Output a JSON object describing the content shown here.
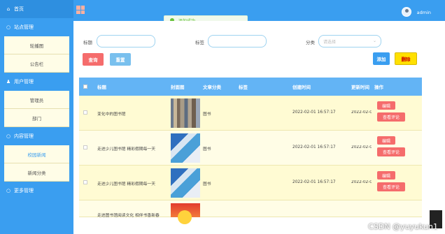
{
  "topbar": {
    "admin_label": "admin"
  },
  "toast": {
    "message": "添加成功"
  },
  "sidebar": {
    "items": [
      {
        "label": "首页",
        "icon": "home-icon"
      },
      {
        "label": "站点管理",
        "icon": "site-icon"
      },
      {
        "label": "轮播图",
        "sub": true
      },
      {
        "label": "公告栏",
        "sub": true
      },
      {
        "label": "用户管理",
        "icon": "user-icon"
      },
      {
        "label": "管理员",
        "sub": true
      },
      {
        "label": "部门",
        "sub": true
      },
      {
        "label": "内容管理",
        "icon": "content-icon"
      },
      {
        "label": "校园新闻",
        "sub": true
      },
      {
        "label": "新闻分类",
        "sub": true
      },
      {
        "label": "更多管理",
        "icon": "more-icon"
      }
    ]
  },
  "search": {
    "title_label": "标题",
    "tag_label": "标签",
    "category_label": "分类",
    "category_placeholder": "请选择",
    "query_button": "查询",
    "reset_button": "重置",
    "add_button": "添加",
    "delete_button": "删除"
  },
  "table": {
    "headers": [
      "标题",
      "封面图",
      "文章分类",
      "标签",
      "创建时间",
      "更新时间",
      "操作"
    ],
    "rows": [
      {
        "title": "变化中的图书馆",
        "category": "图书",
        "created": "2022-02-01 16:57:17",
        "updated": "2022-02-0"
      },
      {
        "title": "走进少儿图书馆 精彩假期每一天",
        "category": "图书",
        "created": "2022-02-01 16:57:17",
        "updated": "2022-02-0"
      },
      {
        "title": "走进少儿图书馆 精彩假期每一天",
        "category": "图书",
        "created": "2022-02-01 16:57:17",
        "updated": "2022-02-0"
      },
      {
        "title": "走进图书馆阅读文化 相伴书香新春",
        "category": "",
        "created": "",
        "updated": ""
      }
    ],
    "edit_button": "编辑",
    "comment_button": "查看评论"
  },
  "watermark": "CSDN @yuyukun1"
}
